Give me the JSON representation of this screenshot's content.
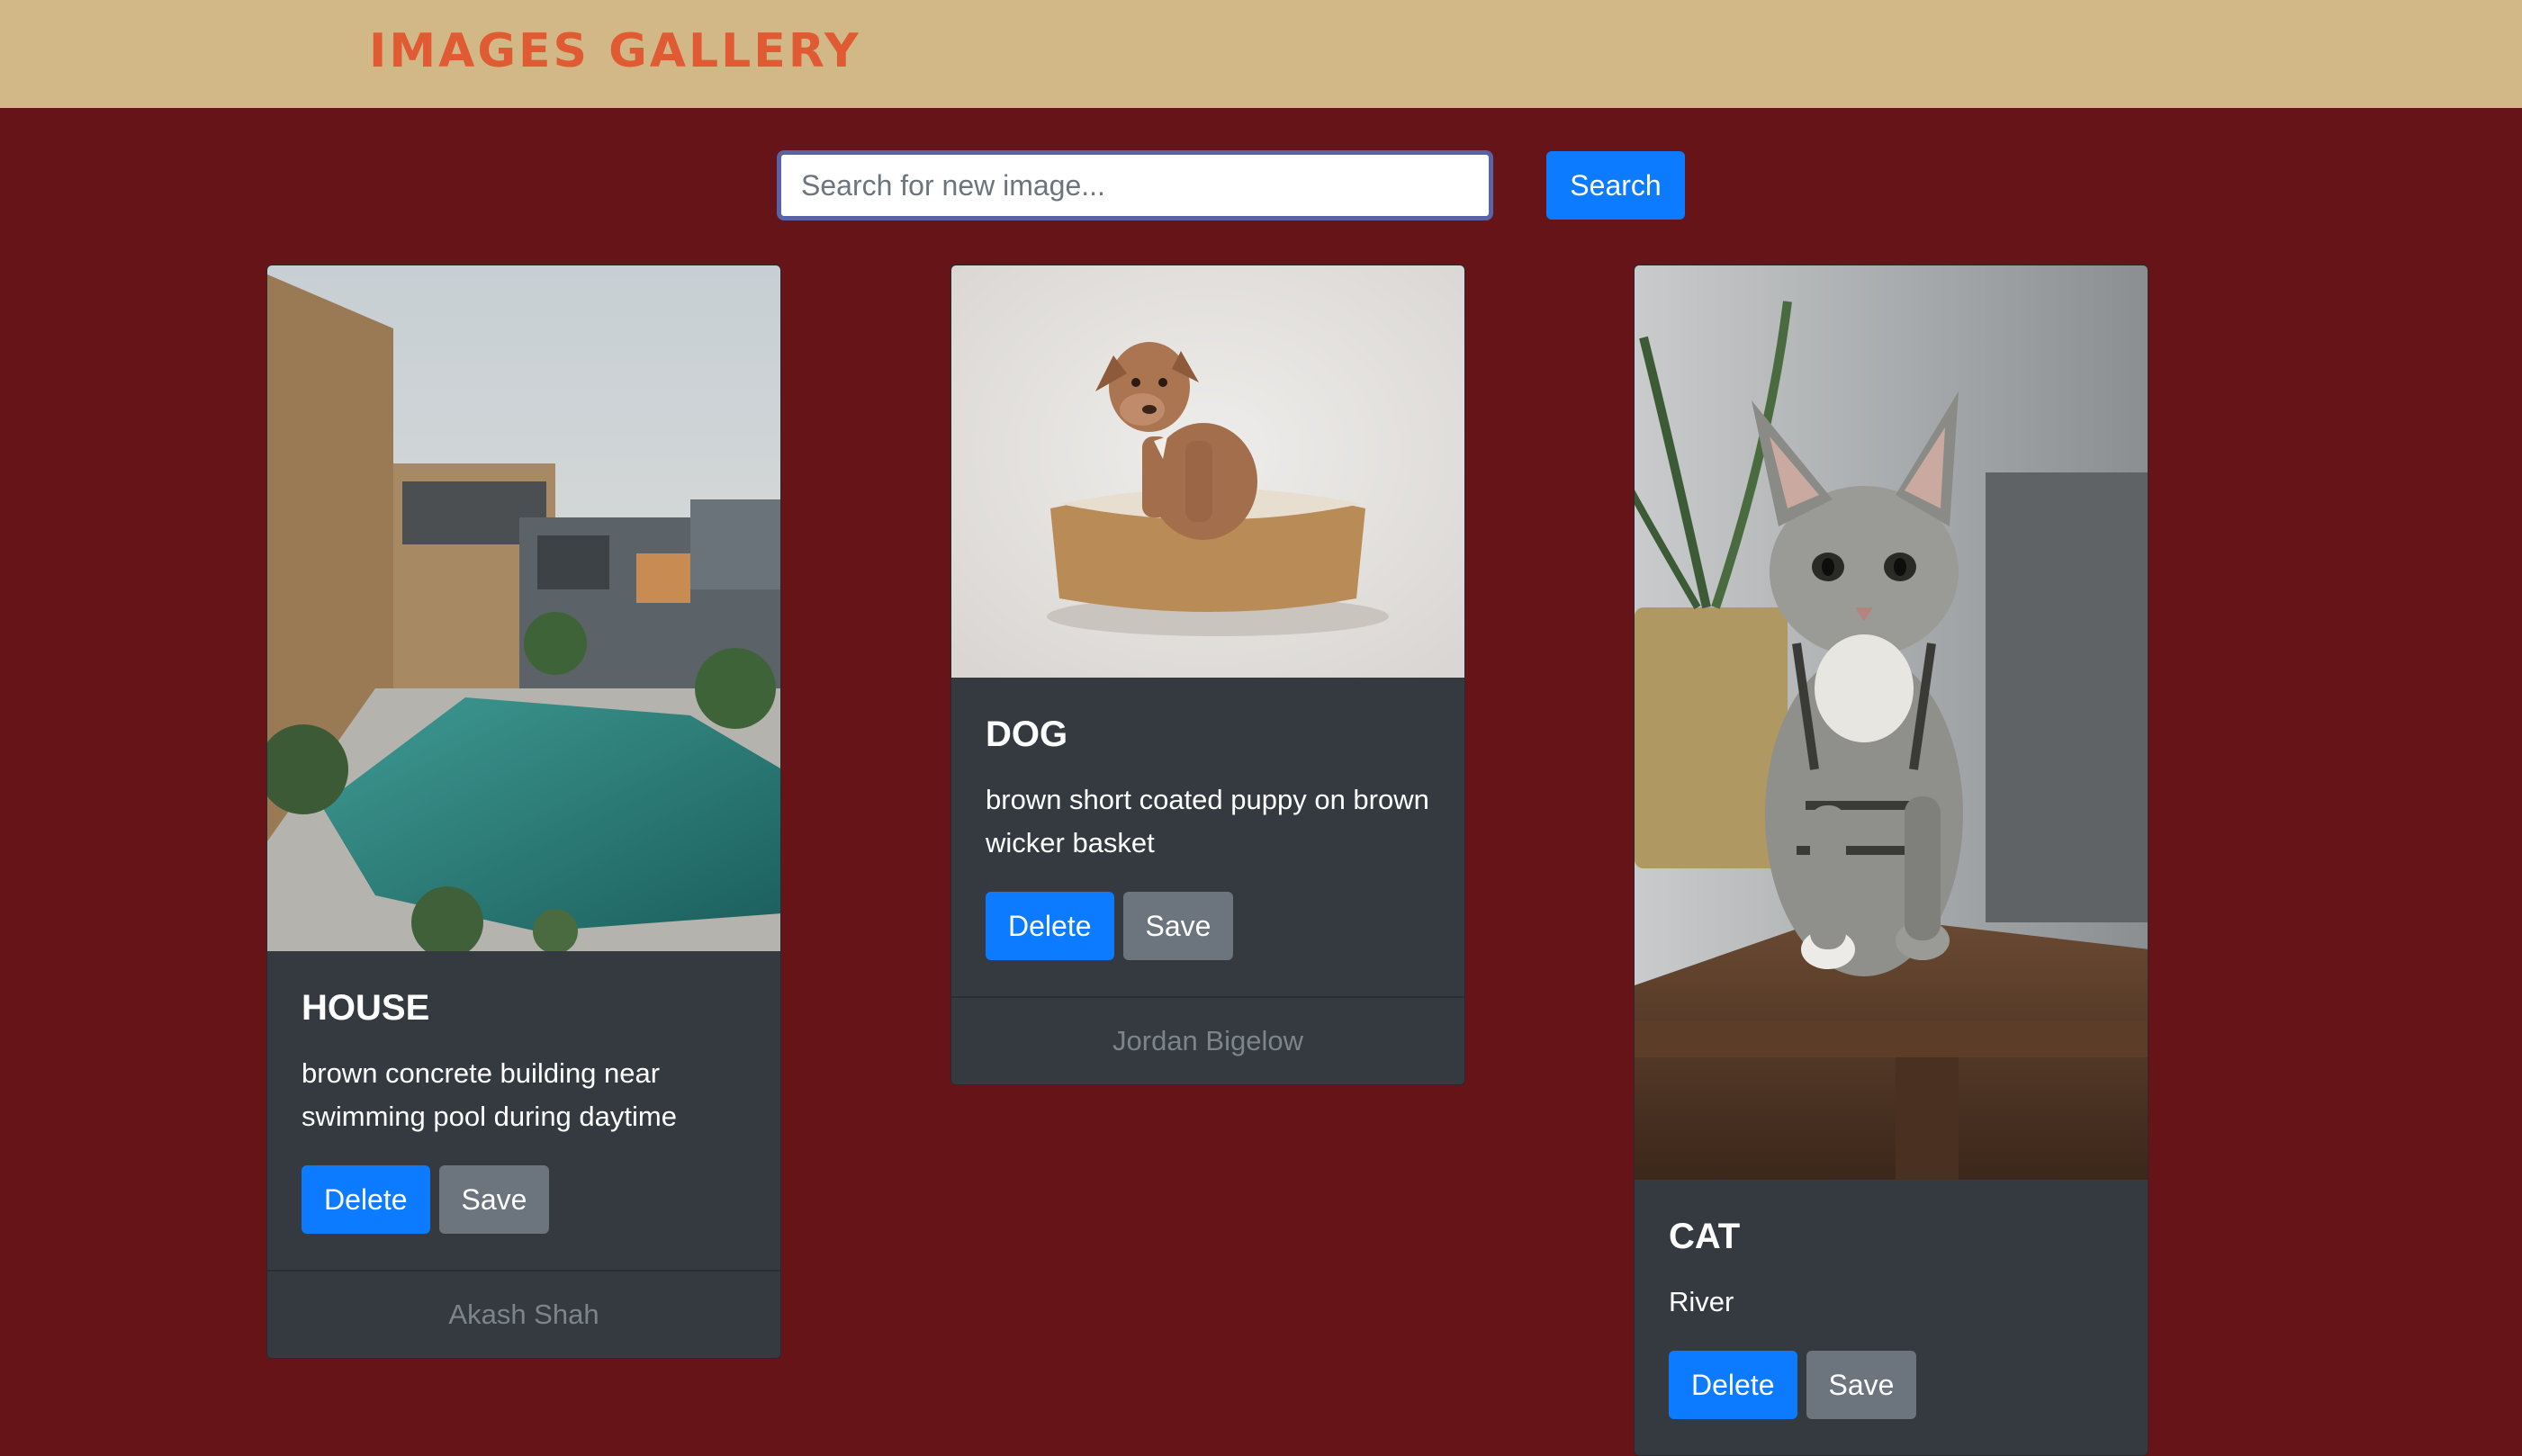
{
  "header": {
    "brand": "Images Gallery"
  },
  "search": {
    "placeholder": "Search for new image...",
    "value": "",
    "button_label": "Search"
  },
  "cards": [
    {
      "title": "HOUSE",
      "description": "brown concrete building near swimming pool during daytime",
      "delete_label": "Delete",
      "save_label": "Save",
      "author": "Akash Shah"
    },
    {
      "title": "DOG",
      "description": "brown short coated puppy on brown wicker basket",
      "delete_label": "Delete",
      "save_label": "Save",
      "author": "Jordan Bigelow"
    },
    {
      "title": "CAT",
      "description": "River",
      "delete_label": "Delete",
      "save_label": "Save",
      "author": ""
    }
  ],
  "colors": {
    "navbar": "#d2b886",
    "brand": "#e05a33",
    "page_background": "#661417",
    "card_background": "#343a40",
    "primary_button": "#0d7bff",
    "secondary_button": "#6c757d"
  }
}
